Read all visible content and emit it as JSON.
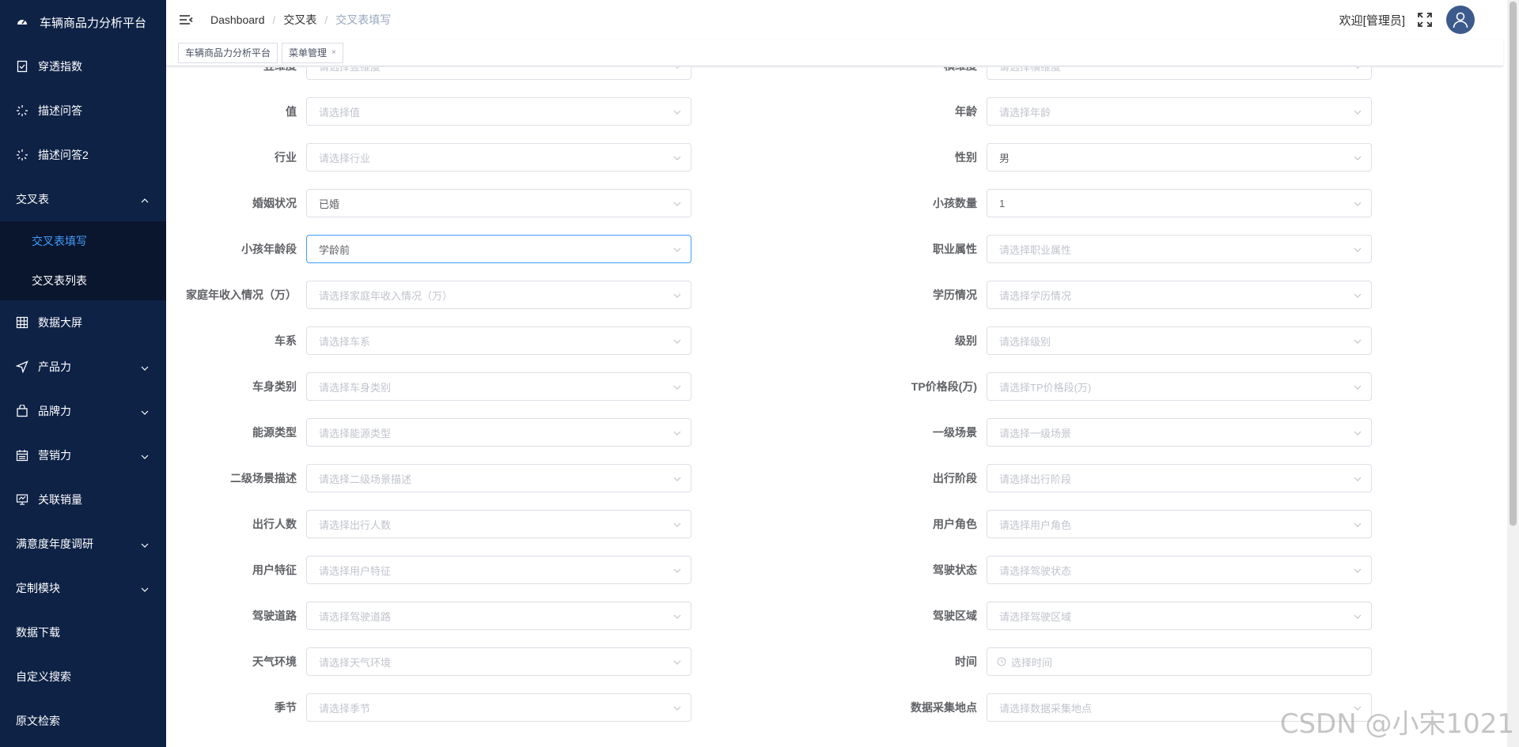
{
  "sidebar": {
    "logo": "车辆商品力分析平台",
    "items": [
      {
        "label": "穿透指数",
        "icon": "document-check-icon"
      },
      {
        "label": "描述问答",
        "icon": "loading-icon"
      },
      {
        "label": "描述问答2",
        "icon": "loading-icon"
      }
    ],
    "cross_table": {
      "label": "交叉表",
      "sub": [
        "交叉表填写",
        "交叉表列表"
      ]
    },
    "items2": [
      {
        "label": "数据大屏",
        "icon": "grid-icon"
      },
      {
        "label": "产品力",
        "icon": "send-icon"
      },
      {
        "label": "品牌力",
        "icon": "bag-icon"
      },
      {
        "label": "营销力",
        "icon": "calendar-icon"
      },
      {
        "label": "关联销量",
        "icon": "monitor-icon"
      }
    ],
    "items3": [
      "满意度年度调研",
      "定制模块",
      "数据下载",
      "自定义搜索",
      "原文检索"
    ]
  },
  "header": {
    "breadcrumb": [
      "Dashboard",
      "交叉表",
      "交叉表填写"
    ],
    "welcome": "欢迎[管理员]"
  },
  "tags": [
    {
      "label": "车辆商品力分析平台"
    },
    {
      "label": "菜单管理",
      "close": "×"
    }
  ],
  "form": {
    "left": [
      {
        "label": "竖维度",
        "placeholder": "请选择竖维度"
      },
      {
        "label": "值",
        "placeholder": "请选择值"
      },
      {
        "label": "行业",
        "placeholder": "请选择行业"
      },
      {
        "label": "婚姻状况",
        "value": "已婚"
      },
      {
        "label": "小孩年龄段",
        "value": "学龄前"
      },
      {
        "label": "家庭年收入情况（万）",
        "placeholder": "请选择家庭年收入情况（万）"
      },
      {
        "label": "车系",
        "placeholder": "请选择车系"
      },
      {
        "label": "车身类别",
        "placeholder": "请选择车身类别"
      },
      {
        "label": "能源类型",
        "placeholder": "请选择能源类型"
      },
      {
        "label": "二级场景描述",
        "placeholder": "请选择二级场景描述"
      },
      {
        "label": "出行人数",
        "placeholder": "请选择出行人数"
      },
      {
        "label": "用户特征",
        "placeholder": "请选择用户特征"
      },
      {
        "label": "驾驶道路",
        "placeholder": "请选择驾驶道路"
      },
      {
        "label": "天气环境",
        "placeholder": "请选择天气环境"
      },
      {
        "label": "季节",
        "placeholder": "请选择季节"
      }
    ],
    "right": [
      {
        "label": "横维度",
        "placeholder": "请选择横维度"
      },
      {
        "label": "年龄",
        "placeholder": "请选择年龄"
      },
      {
        "label": "性别",
        "value": "男"
      },
      {
        "label": "小孩数量",
        "value": "1"
      },
      {
        "label": "职业属性",
        "placeholder": "请选择职业属性"
      },
      {
        "label": "学历情况",
        "placeholder": "请选择学历情况"
      },
      {
        "label": "级别",
        "placeholder": "请选择级别"
      },
      {
        "label": "TP价格段(万)",
        "placeholder": "请选择TP价格段(万)"
      },
      {
        "label": "一级场景",
        "placeholder": "请选择一级场景"
      },
      {
        "label": "出行阶段",
        "placeholder": "请选择出行阶段"
      },
      {
        "label": "用户角色",
        "placeholder": "请选择用户角色"
      },
      {
        "label": "驾驶状态",
        "placeholder": "请选择驾驶状态"
      },
      {
        "label": "驾驶区域",
        "placeholder": "请选择驾驶区域"
      },
      {
        "label": "时间",
        "placeholder": "选择时间",
        "time": true
      },
      {
        "label": "数据采集地点",
        "placeholder": "请选择数据采集地点"
      }
    ]
  },
  "watermark": "CSDN @小宋1021",
  "colors": {
    "sidebar": "#0e2246",
    "active": "#409eff"
  }
}
